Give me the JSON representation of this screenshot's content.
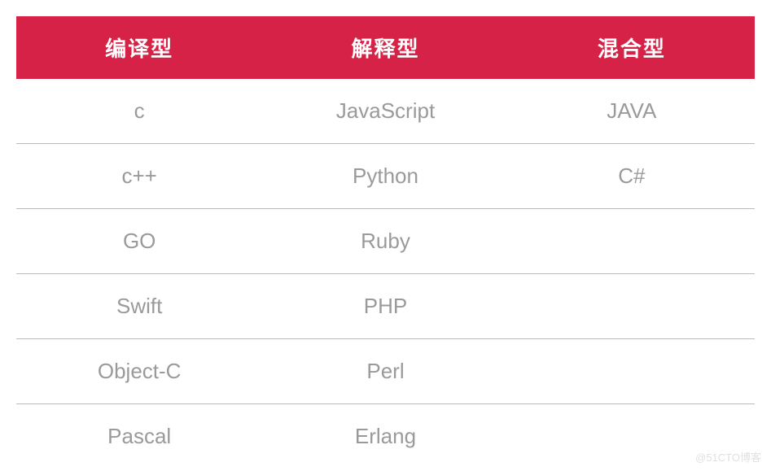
{
  "table": {
    "headers": [
      "编译型",
      "解释型",
      "混合型"
    ],
    "rows": [
      [
        "c",
        "JavaScript",
        "JAVA"
      ],
      [
        "c++",
        "Python",
        "C#"
      ],
      [
        "GO",
        "Ruby",
        ""
      ],
      [
        "Swift",
        "PHP",
        ""
      ],
      [
        "Object-C",
        "Perl",
        ""
      ],
      [
        "Pascal",
        "Erlang",
        ""
      ]
    ]
  },
  "watermark": "@51CTO博客"
}
